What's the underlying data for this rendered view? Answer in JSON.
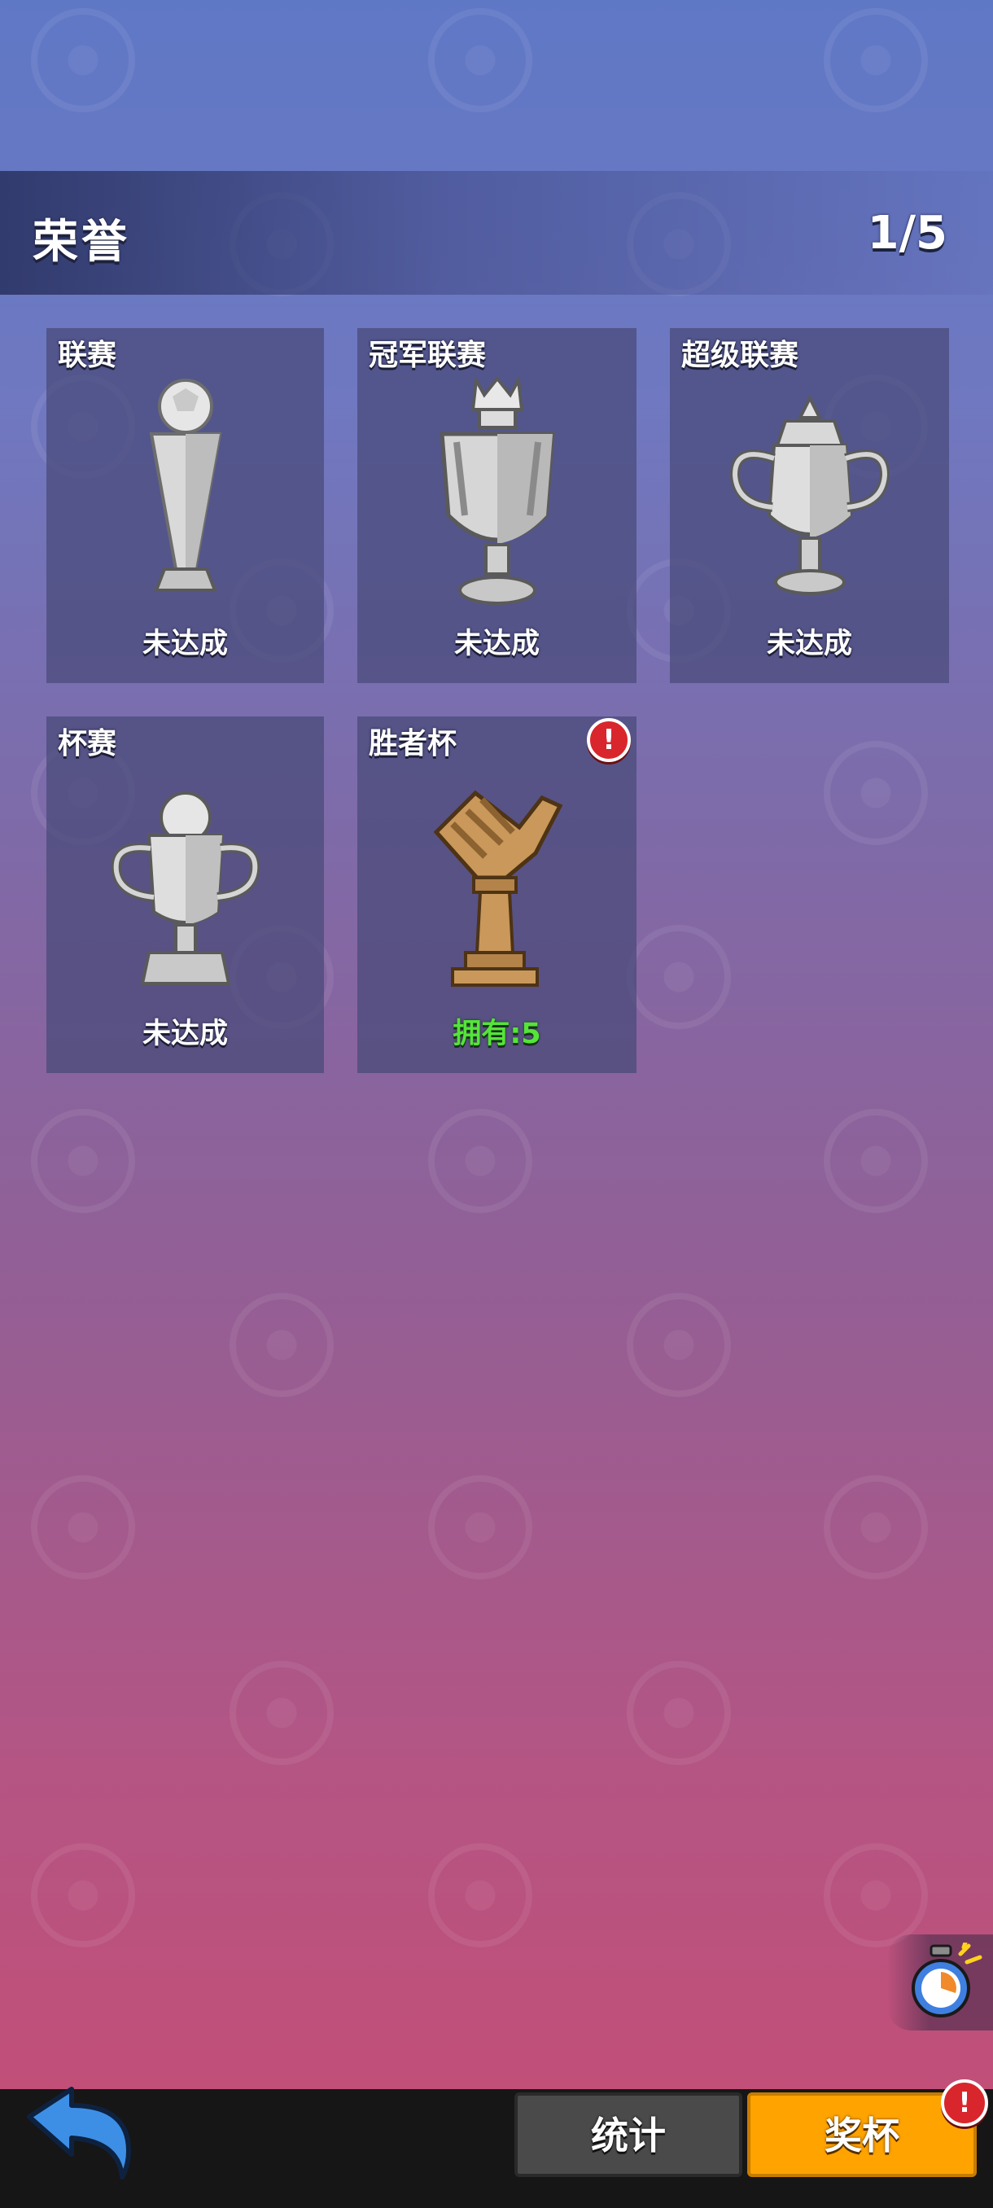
{
  "header": {
    "title": "荣誉",
    "progress": "1/5"
  },
  "trophies": [
    {
      "label": "联赛",
      "status": "未达成",
      "icon": "league-trophy-icon",
      "unlocked": false
    },
    {
      "label": "冠军联赛",
      "status": "未达成",
      "icon": "champions-league-trophy-icon",
      "unlocked": false
    },
    {
      "label": "超级联赛",
      "status": "未达成",
      "icon": "super-league-trophy-icon",
      "unlocked": false
    },
    {
      "label": "杯赛",
      "status": "未达成",
      "icon": "cup-trophy-icon",
      "unlocked": false
    },
    {
      "label": "胜者杯",
      "status": "拥有:5",
      "icon": "winner-cup-trophy-icon",
      "unlocked": true,
      "notification": "!"
    }
  ],
  "bottom_nav": {
    "stats_label": "统计",
    "trophies_label": "奖杯",
    "trophies_notification": "!"
  },
  "colors": {
    "status_owned": "#55e438",
    "active_tab": "#ffa300",
    "inactive_tab": "#4a4a4a",
    "notification_badge": "#d8262c",
    "back_arrow": "#3d8fe6"
  }
}
